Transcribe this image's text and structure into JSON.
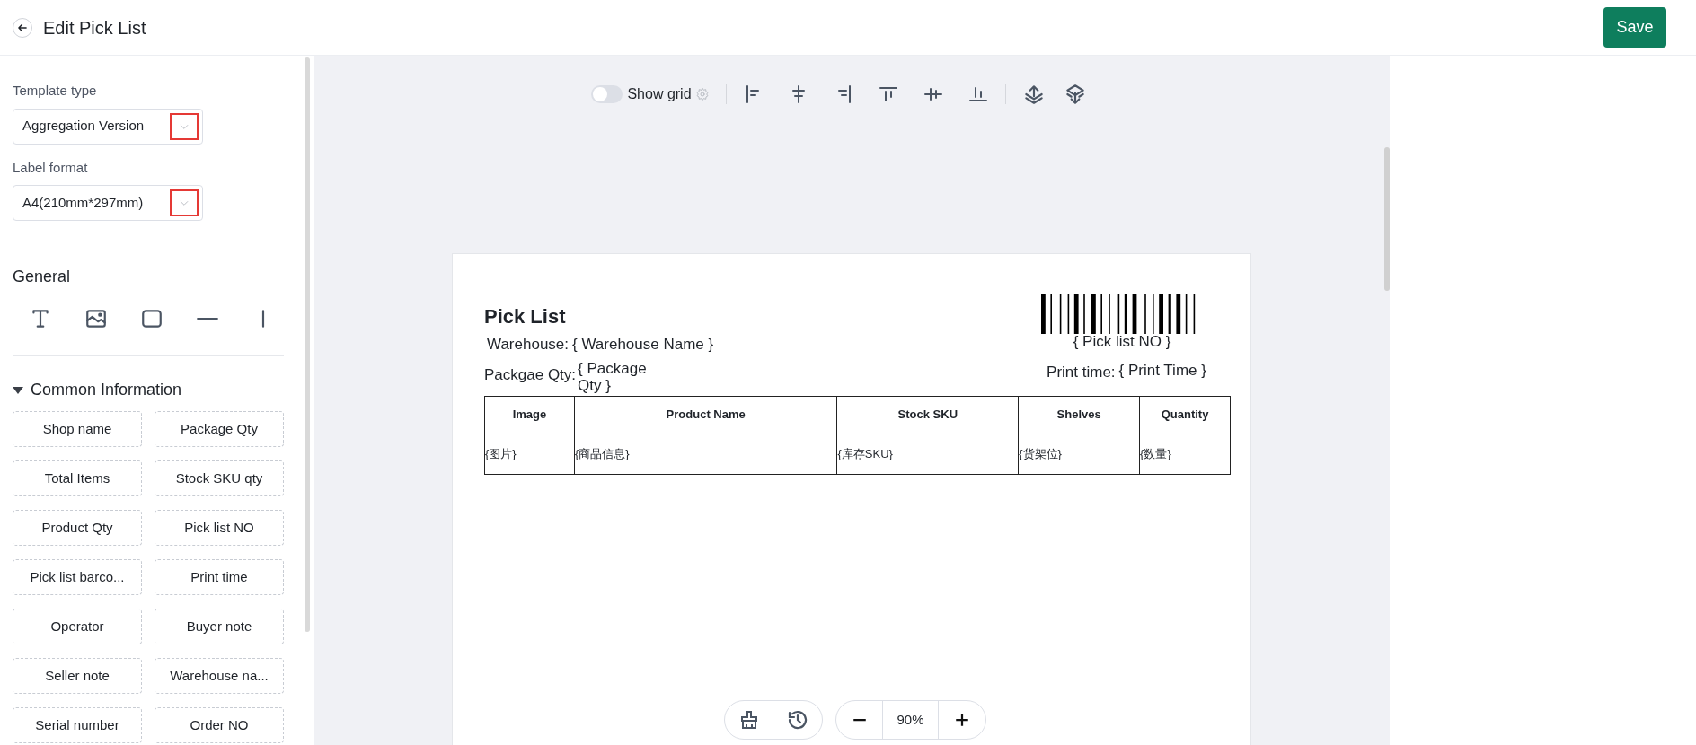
{
  "header": {
    "title": "Edit Pick List",
    "save_button": "Save"
  },
  "sidebar": {
    "fields": [
      {
        "label": "Template type",
        "value": "Aggregation Version",
        "highlighted": true
      },
      {
        "label": "Label format",
        "value": "A4(210mm*297mm)",
        "highlighted": true
      }
    ],
    "general": {
      "title": "General"
    },
    "common_information": {
      "title": "Common Information",
      "expanded": true,
      "items": [
        "Shop name",
        "Package Qty",
        "Total Items",
        "Stock SKU qty",
        "Product Qty",
        "Pick list NO",
        "Pick list barco...",
        "Print time",
        "Operator",
        "Buyer note",
        "Seller note",
        "Warehouse na...",
        "Serial number",
        "Order NO"
      ]
    }
  },
  "toolbar": {
    "show_grid": {
      "label": "Show grid",
      "on": false
    }
  },
  "label": {
    "title": "Pick List",
    "warehouse": {
      "label": "Warehouse:",
      "value": "{ Warehouse Name }"
    },
    "package_qty": {
      "label": "Packgae Qty:",
      "value": "{ Package Qty }"
    },
    "barcode_text": "{ Pick list NO }",
    "print_time": {
      "label": "Print time:",
      "value": "{ Print Time }"
    },
    "table": {
      "columns": [
        "Image",
        "Product Name",
        "Stock SKU",
        "Shelves",
        "Quantity"
      ],
      "rows": [
        [
          "{图片}",
          "{商品信息}",
          "{库存SKU}",
          "{货架位}",
          "{数量}"
        ]
      ]
    }
  },
  "zoom": {
    "value": "90%"
  }
}
